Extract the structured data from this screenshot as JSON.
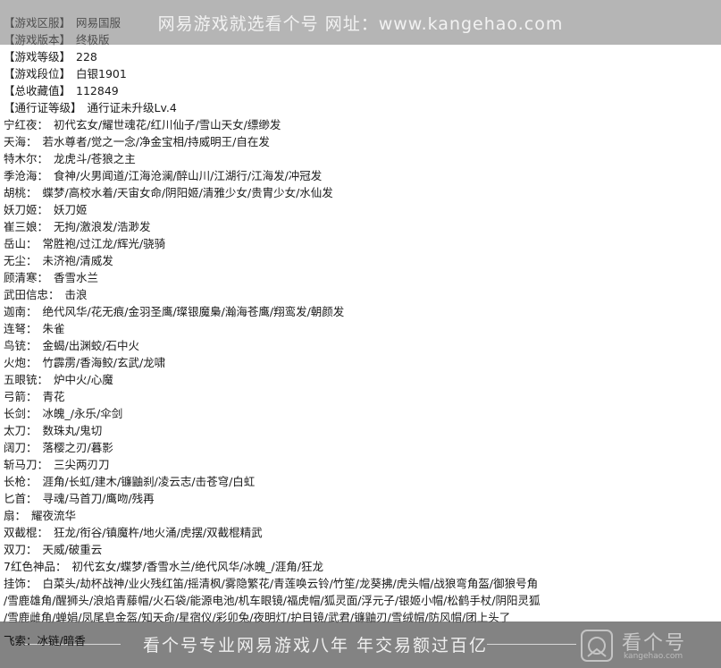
{
  "top_banner": {
    "text": "网易游戏就选看个号   网址：www.kangehao.com"
  },
  "lines": [
    {
      "k": "【游戏区服】",
      "v": "网易国服"
    },
    {
      "k": "【游戏版本】",
      "v": "终极版"
    },
    {
      "k": "【游戏等级】",
      "v": "228"
    },
    {
      "k": "【游戏段位】",
      "v": "白银1901"
    },
    {
      "k": "【总收藏值】",
      "v": "112849"
    },
    {
      "k": "【通行证等级】",
      "v": "通行证未升级Lv.4"
    },
    {
      "k": "宁红夜：",
      "v": "初代玄女/耀世魂花/红川仙子/雪山天女/缥缈发"
    },
    {
      "k": "天海：",
      "v": "若水尊者/觉之一念/净金宝相/持威明王/自在发"
    },
    {
      "k": "特木尔：",
      "v": "龙虎斗/苍狼之主"
    },
    {
      "k": "季沧海：",
      "v": "食神/火男闻道/江海沧澜/醉山川/江湖行/江海发/冲冠发"
    },
    {
      "k": "胡桃：",
      "v": "蝶梦/高校水着/天宙女命/阴阳姬/清雅少女/贵胄少女/水仙发"
    },
    {
      "k": "妖刀姬：",
      "v": "妖刀姬"
    },
    {
      "k": "崔三娘：",
      "v": "无拘/激浪发/浩渺发"
    },
    {
      "k": "岳山：",
      "v": "常胜袍/过江龙/辉光/骁骑"
    },
    {
      "k": "无尘：",
      "v": "未济袍/清威发"
    },
    {
      "k": "顾清寒：",
      "v": "香雪水兰"
    },
    {
      "k": "武田信忠：",
      "v": "击浪"
    },
    {
      "k": "迦南：",
      "v": "绝代风华/花无痕/金羽圣鹰/璨银魔梟/瀚海苍鹰/翔鸾发/朝颜发"
    },
    {
      "k": "连弩：",
      "v": "朱雀"
    },
    {
      "k": "鸟铳：",
      "v": "金蝎/出渊蛟/石中火"
    },
    {
      "k": "火炮：",
      "v": "竹霹雳/香海鲛/玄武/龙啸"
    },
    {
      "k": "五眼铳：",
      "v": "炉中火/心魔"
    },
    {
      "k": "弓箭：",
      "v": "青花"
    },
    {
      "k": "长剑：",
      "v": "冰魄_/永乐/伞剑"
    },
    {
      "k": "太刀：",
      "v": "数珠丸/鬼切"
    },
    {
      "k": "阔刀：",
      "v": "落樱之刃/暮影"
    },
    {
      "k": "斩马刀：",
      "v": "三尖两刃刀"
    },
    {
      "k": "长枪：",
      "v": "涯角/长虹/建木/镰鼬刹/凌云志/击苍穹/白虹"
    },
    {
      "k": "匕首：",
      "v": "寻魂/马首刀/鹰吻/残再"
    },
    {
      "k": "扇：",
      "v": "耀夜流华"
    },
    {
      "k": "双截棍：",
      "v": "狂龙/衔谷/镇魔杵/地火涌/虎摆/双截棍精武"
    },
    {
      "k": "双刀：",
      "v": "天威/破重云"
    },
    {
      "k": "7红色神品：",
      "v": "初代玄女/蝶梦/香雪水兰/绝代风华/冰魄_/涯角/狂龙"
    },
    {
      "k": "挂饰：",
      "v": "白菜头/劫杯战神/业火残红笛/摇清枫/雾隐繁花/青莲唤云铃/竹笙/龙葵拂/虎头帽/战狼弯角盔/御狼号角"
    },
    {
      "k": "",
      "v": "/雪鹿雄角/醒狮头/浪焰青藤帽/火石袋/能源电池/机车眼镜/福虎帽/狐灵面/浮元子/银姬小帽/松鹤手杖/阴阳灵狐"
    },
    {
      "k": "",
      "v": "/雪鹿雌角/蝉娟/凤尾皂金盔/知天命/星宿仪/彩卯兔/夜明灯/护目镜/武君/镰鼬刃/雪绒帽/防风帽/团上头了"
    }
  ],
  "last_line": "飞索：冰链/暗香",
  "bottom_banner": {
    "text": "看个号专业网易游戏八年   年交易额过百亿"
  },
  "watermark": {
    "brand": "看个号",
    "url": "kangehao.com"
  }
}
